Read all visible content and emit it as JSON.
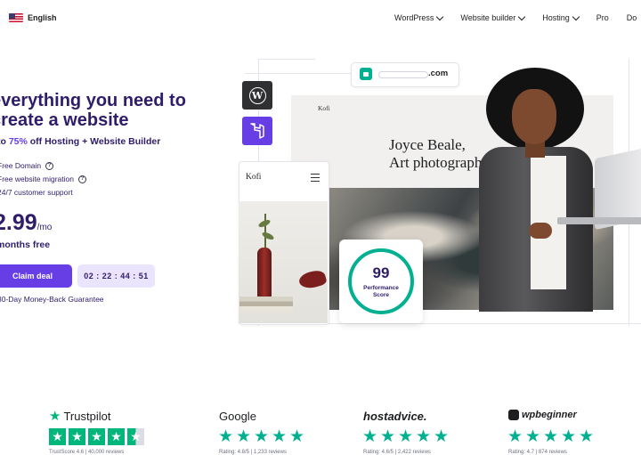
{
  "nav": {
    "language": "English",
    "items": [
      {
        "label": "WordPress",
        "has_dropdown": true
      },
      {
        "label": "Website builder",
        "has_dropdown": true
      },
      {
        "label": "Hosting",
        "has_dropdown": true
      },
      {
        "label": "Pro",
        "has_dropdown": false
      },
      {
        "label": "Do",
        "has_dropdown": false
      }
    ]
  },
  "hero": {
    "headline": "everything you need to\ncreate a website",
    "sub_prefix": "to ",
    "sub_highlight": "75%",
    "sub_suffix": " off Hosting + Website Builder",
    "features": [
      "Free Domain",
      "Free website migration",
      "24/7 customer support"
    ],
    "price": "2.99",
    "price_unit": "/mo",
    "months_free": "months free",
    "claim_label": "Claim deal",
    "timer": "02 : 22 : 44 : 51",
    "guarantee": "30-Day Money-Back Guarantee"
  },
  "illustration": {
    "domain_suffix": ".com",
    "site_brand": "Kofi",
    "site_heading": "Joyce Beale,\nArt photograph",
    "mobile_brand": "Kofi",
    "performance_score": 99,
    "performance_label": "Performance\nScore"
  },
  "reviews": [
    {
      "brand": "Trustpilot",
      "stars": 4.5,
      "line": "TrustScore 4.6 | 40,000 reviews"
    },
    {
      "brand": "Google",
      "stars": 5,
      "line": "Rating: 4.8/5 | 1,233 reviews"
    },
    {
      "brand": "hostadvice.",
      "stars": 5,
      "line": "Rating: 4.6/5 | 2,422 reviews"
    },
    {
      "brand": "wpbeginner",
      "stars": 5,
      "line": "Rating: 4.7 | 874 reviews"
    }
  ],
  "colors": {
    "primary": "#673de6",
    "dark": "#2f1c6a",
    "success": "#00b090",
    "trustpilot": "#00b67a"
  }
}
